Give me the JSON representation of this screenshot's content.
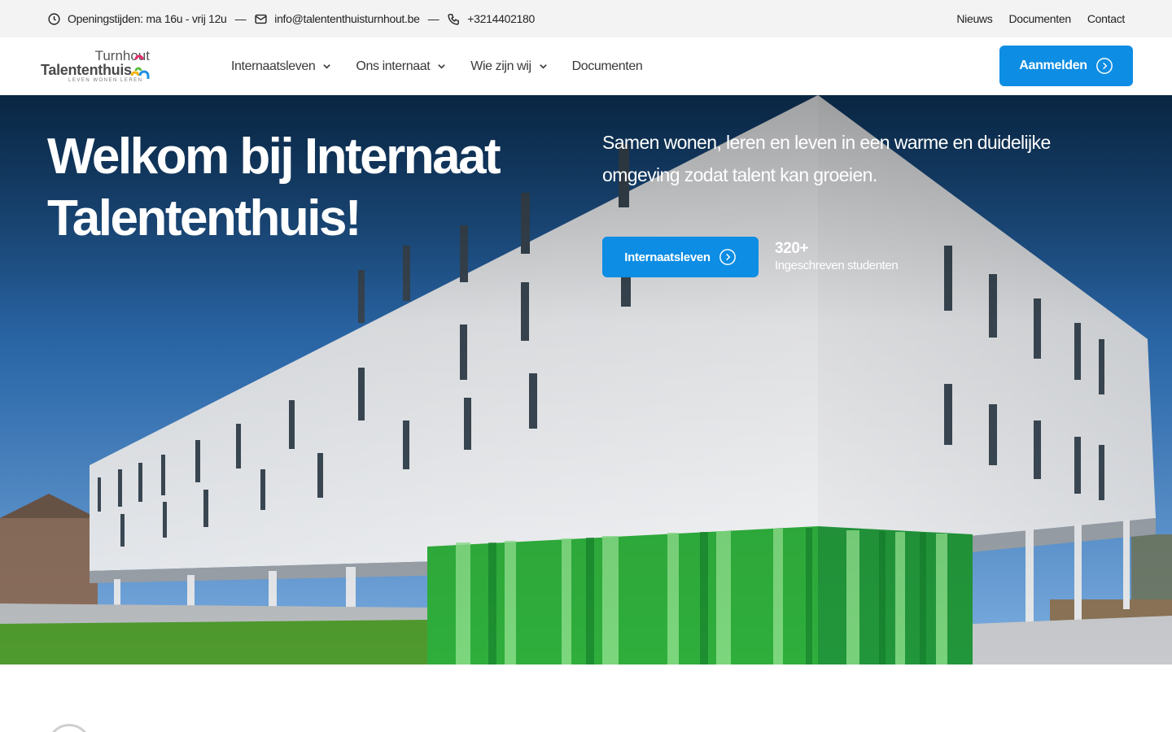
{
  "topbar": {
    "hours": "Openingstijden: ma 16u - vrij 12u",
    "email": "info@talententhuisturnhout.be",
    "phone": "+3214402180",
    "separator": "—",
    "links": [
      "Nieuws",
      "Documenten",
      "Contact"
    ]
  },
  "logo": {
    "city": "Turnhout",
    "name": "Talententhuis",
    "tagline": "LEVEN  WONEN  LEREN"
  },
  "nav": {
    "items": [
      "Internaatsleven",
      "Ons internaat",
      "Wie zijn wij",
      "Documenten"
    ],
    "cta": "Aanmelden"
  },
  "hero": {
    "title": "Welkom bij Internaat Talententhuis!",
    "lead": "Samen wonen, leren en leven in een warme en duidelijke omgeving zodat talent kan groeien.",
    "button": "Internaatsleven",
    "stat_value": "320+",
    "stat_label": "Ingeschreven studenten"
  },
  "colors": {
    "accent": "#0d8de3",
    "topbar_bg": "#f3f3f3",
    "sky_top": "#0e3a66",
    "facade_green": "#2fae3c"
  }
}
